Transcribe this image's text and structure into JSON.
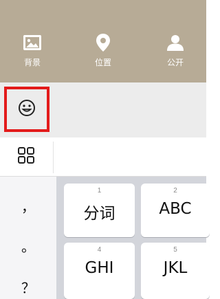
{
  "toolbar": {
    "items": [
      {
        "label": "背景",
        "icon": "image-icon"
      },
      {
        "label": "位置",
        "icon": "location-pin-icon"
      },
      {
        "label": "公开",
        "icon": "person-icon"
      }
    ]
  },
  "emoji_bar": {
    "icon": "emoji-smiley-icon",
    "highlight_color": "#e31b1b"
  },
  "keyboard": {
    "menu_icon": "grid-menu-icon",
    "punctuation": [
      "，",
      "。",
      "？"
    ],
    "keys": [
      {
        "number": "1",
        "label": "分词"
      },
      {
        "number": "2",
        "label": "ABC"
      },
      {
        "number": "4",
        "label": "GHI"
      },
      {
        "number": "5",
        "label": "JKL"
      }
    ]
  }
}
